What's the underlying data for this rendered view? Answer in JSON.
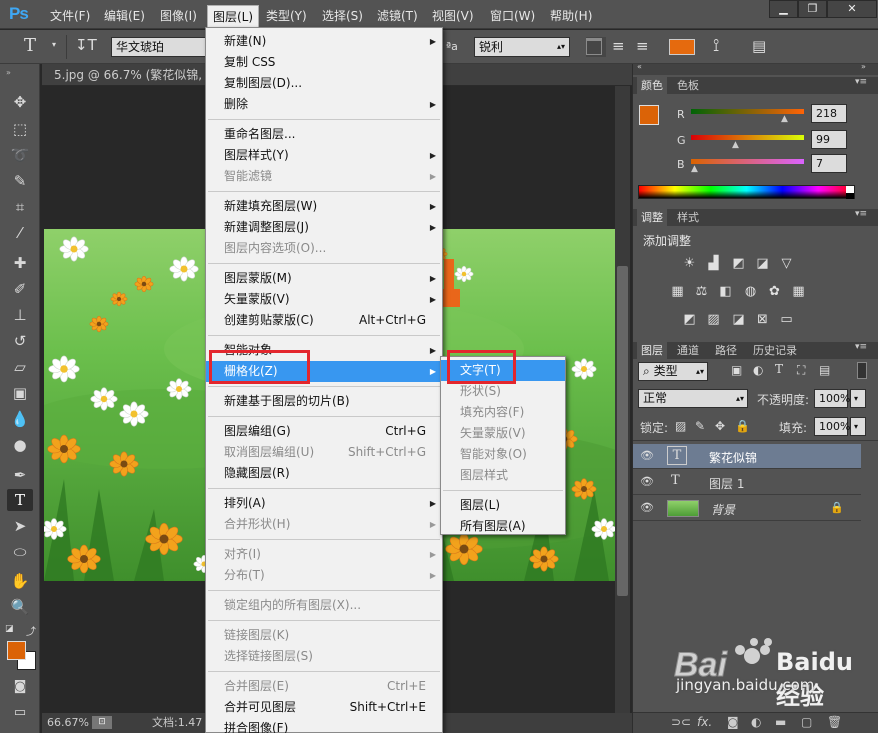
{
  "app": {
    "logo": "Ps"
  },
  "menubar": [
    {
      "label": "文件(F)"
    },
    {
      "label": "编辑(E)"
    },
    {
      "label": "图像(I)"
    },
    {
      "label": "图层(L)"
    },
    {
      "label": "类型(Y)"
    },
    {
      "label": "选择(S)"
    },
    {
      "label": "滤镜(T)"
    },
    {
      "label": "视图(V)"
    },
    {
      "label": "窗口(W)"
    },
    {
      "label": "帮助(H)"
    }
  ],
  "window_controls": [
    "minimize-icon",
    "restore-icon",
    "close-icon"
  ],
  "options": {
    "font_family": "华文琥珀",
    "antialias": "锐利",
    "aa_prefix": "ªa",
    "text_color": "#e56a0e"
  },
  "document": {
    "tab": "5.jpg @ 66.7% (繁花似锦, R",
    "zoom": "66.67%",
    "docinfo": "文档:1.47"
  },
  "colors": {
    "foreground": "#db6307",
    "background": "#ffffff",
    "accent": "#3897f0",
    "highlight_box": "#e3262d"
  },
  "color_panel": {
    "tabs": [
      "颜色",
      "色板"
    ],
    "channels": [
      {
        "label": "R",
        "value": "218"
      },
      {
        "label": "G",
        "value": "99"
      },
      {
        "label": "B",
        "value": "7"
      }
    ]
  },
  "adjust_panel": {
    "tabs": [
      "调整",
      "样式"
    ],
    "title": "添加调整"
  },
  "layers_panel": {
    "tabs": [
      "图层",
      "通道",
      "路径",
      "历史记录"
    ],
    "filter": "类型",
    "blend": "正常",
    "opacity_label": "不透明度:",
    "opacity": "100%",
    "lock_label": "锁定:",
    "fill_label": "填充:",
    "fill": "100%",
    "layers": [
      {
        "name": "繁花似锦",
        "type": "T",
        "selected": true
      },
      {
        "name": "图层 1",
        "type": "T",
        "selected": false
      },
      {
        "name": "背景",
        "type": "image",
        "selected": false
      }
    ]
  },
  "layer_menu": {
    "items": [
      {
        "label": "新建(N)",
        "submenu": true
      },
      {
        "label": "复制 CSS"
      },
      {
        "label": "复制图层(D)..."
      },
      {
        "label": "删除",
        "submenu": true
      },
      {
        "sep": true
      },
      {
        "label": "重命名图层..."
      },
      {
        "label": "图层样式(Y)",
        "submenu": true
      },
      {
        "label": "智能滤镜",
        "disabled": true,
        "submenu": true
      },
      {
        "sep": true
      },
      {
        "label": "新建填充图层(W)",
        "submenu": true
      },
      {
        "label": "新建调整图层(J)",
        "submenu": true
      },
      {
        "label": "图层内容选项(O)...",
        "disabled": true
      },
      {
        "sep": true
      },
      {
        "label": "图层蒙版(M)",
        "submenu": true
      },
      {
        "label": "矢量蒙版(V)",
        "submenu": true
      },
      {
        "label": "创建剪贴蒙版(C)",
        "shortcut": "Alt+Ctrl+G"
      },
      {
        "sep": true
      },
      {
        "label": "智能对象",
        "submenu": true
      },
      {
        "label": "栅格化(Z)",
        "submenu": true,
        "highlighted": true,
        "boxed": true
      },
      {
        "sep": true
      },
      {
        "label": "新建基于图层的切片(B)"
      },
      {
        "sep": true
      },
      {
        "label": "图层编组(G)",
        "shortcut": "Ctrl+G"
      },
      {
        "label": "取消图层编组(U)",
        "shortcut": "Shift+Ctrl+G",
        "disabled": true
      },
      {
        "label": "隐藏图层(R)"
      },
      {
        "sep": true
      },
      {
        "label": "排列(A)",
        "submenu": true
      },
      {
        "label": "合并形状(H)",
        "disabled": true,
        "submenu": true
      },
      {
        "sep": true
      },
      {
        "label": "对齐(I)",
        "disabled": true,
        "submenu": true
      },
      {
        "label": "分布(T)",
        "disabled": true,
        "submenu": true
      },
      {
        "sep": true
      },
      {
        "label": "锁定组内的所有图层(X)...",
        "disabled": true
      },
      {
        "sep": true
      },
      {
        "label": "链接图层(K)",
        "disabled": true
      },
      {
        "label": "选择链接图层(S)",
        "disabled": true
      },
      {
        "sep": true
      },
      {
        "label": "合并图层(E)",
        "shortcut": "Ctrl+E",
        "disabled": true
      },
      {
        "label": "合并可见图层",
        "shortcut": "Shift+Ctrl+E"
      },
      {
        "label": "拼合图像(F)"
      }
    ]
  },
  "rasterize_menu": {
    "items": [
      {
        "label": "文字(T)",
        "highlighted": true,
        "boxed": true
      },
      {
        "label": "形状(S)",
        "disabled": true
      },
      {
        "label": "填充内容(F)",
        "disabled": true
      },
      {
        "label": "矢量蒙版(V)",
        "disabled": true
      },
      {
        "label": "智能对象(O)",
        "disabled": true
      },
      {
        "label": "图层样式",
        "disabled": true
      },
      {
        "sep": true
      },
      {
        "label": "图层(L)"
      },
      {
        "label": "所有图层(A)"
      }
    ]
  },
  "watermark": {
    "text": "Baidu经验",
    "url": "jingyan.baidu.com"
  }
}
